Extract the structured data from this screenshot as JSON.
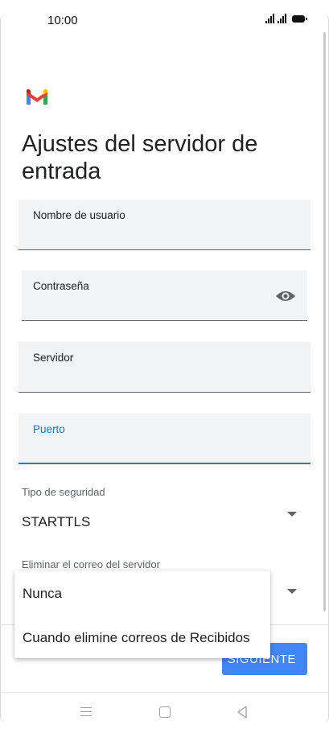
{
  "status_bar": {
    "time": "10:00"
  },
  "header": {
    "title": "Ajustes del servidor de entrada"
  },
  "form": {
    "username": {
      "label": "Nombre de usuario",
      "value": ""
    },
    "password": {
      "label": "Contraseña",
      "value": ""
    },
    "server": {
      "label": "Servidor",
      "value": ""
    },
    "port": {
      "label": "Puerto",
      "value": ""
    },
    "security": {
      "label": "Tipo de seguridad",
      "value": "STARTTLS"
    },
    "delete_from_server": {
      "label": "Eliminar el correo del servidor",
      "value": "Nunca"
    }
  },
  "dropdown": {
    "options": [
      "Nunca",
      "Cuando elimine correos de Recibidos"
    ]
  },
  "footer": {
    "next_label": "SIGUIENTE"
  },
  "colors": {
    "accent": "#1a73e8",
    "button": "#4285f4",
    "field_bg": "#f1f3f4"
  },
  "icons": [
    "gmail-logo",
    "eye-icon",
    "dropdown-arrow-icon",
    "nav-menu-icon",
    "nav-home-icon",
    "nav-back-icon"
  ]
}
